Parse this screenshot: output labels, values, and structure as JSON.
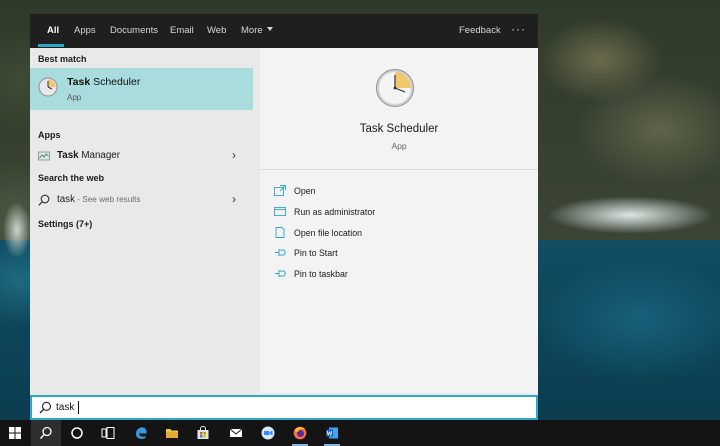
{
  "nav": {
    "tabs": [
      {
        "label": "All",
        "active": true
      },
      {
        "label": "Apps"
      },
      {
        "label": "Documents"
      },
      {
        "label": "Email"
      },
      {
        "label": "Web"
      },
      {
        "label": "More"
      }
    ],
    "feedback": "Feedback",
    "more_dots": "···"
  },
  "left": {
    "best_match_header": "Best match",
    "best_match": {
      "title_bold": "Task",
      "title_rest": " Scheduler",
      "subtitle": "App",
      "icon": "clock-icon"
    },
    "apps_header": "Apps",
    "apps": [
      {
        "bold": "Task",
        "rest": " Manager",
        "icon": "task-manager-icon"
      }
    ],
    "web_header": "Search the web",
    "web": {
      "query": "task",
      "hint": " - See web results",
      "icon": "search-icon"
    },
    "settings_header": "Settings (7+)"
  },
  "right": {
    "title": "Task Scheduler",
    "subtitle": "App",
    "actions": [
      {
        "label": "Open",
        "icon": "open-icon"
      },
      {
        "label": "Run as administrator",
        "icon": "admin-icon"
      },
      {
        "label": "Open file location",
        "icon": "folder-location-icon"
      },
      {
        "label": "Pin to Start",
        "icon": "pin-icon"
      },
      {
        "label": "Pin to taskbar",
        "icon": "pin-icon"
      }
    ]
  },
  "search": {
    "value": "task"
  },
  "taskbar": {
    "items": [
      "windows-icon",
      "search-icon",
      "cortana-icon",
      "task-view-icon",
      "edge-icon",
      "file-explorer-icon",
      "store-icon",
      "mail-icon",
      "zoom-icon",
      "firefox-icon",
      "word-icon"
    ]
  },
  "colors": {
    "accent": "#2fa8c8",
    "selection": "#a9dcdd",
    "nav_bg": "#1f1f1f",
    "taskbar_bg": "#141414"
  }
}
